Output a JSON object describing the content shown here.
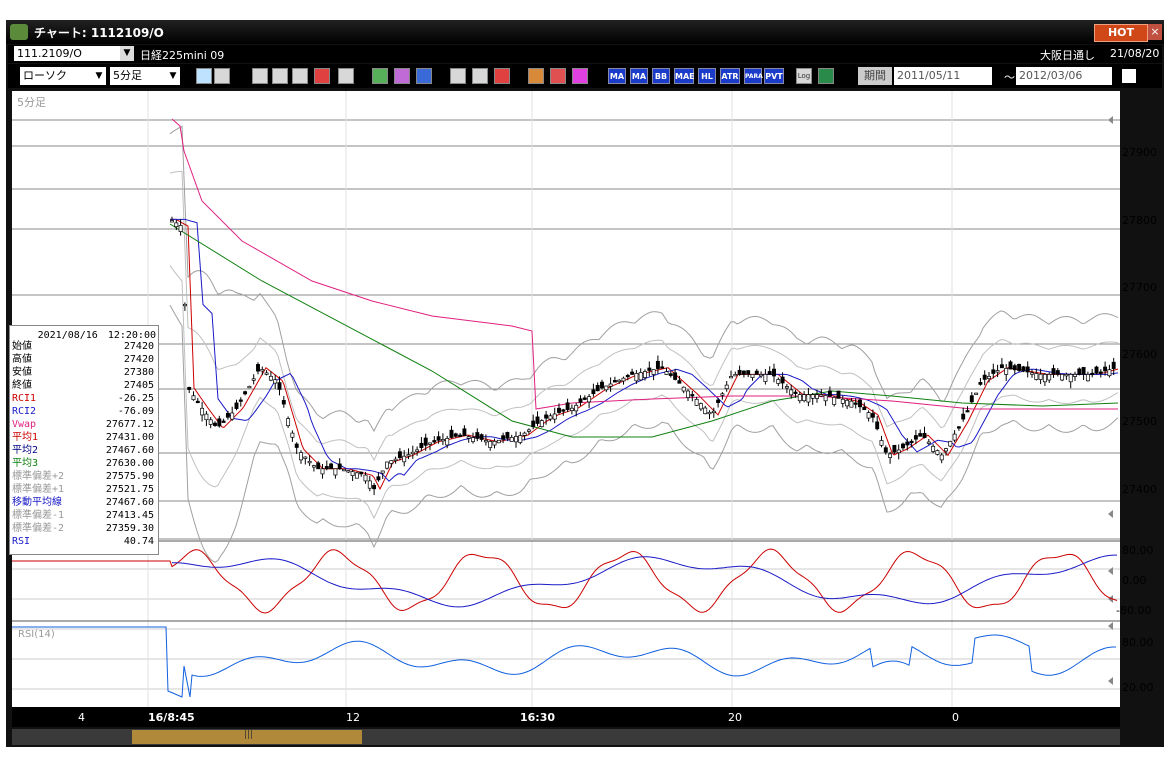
{
  "window": {
    "title": "チャート: 1112109/O",
    "hot_label": "HOT",
    "close_label": "×"
  },
  "info": {
    "symbol": "111.2109/O",
    "name": "日経225mini 09",
    "session": "大阪日通し",
    "date": "21/08/20"
  },
  "toolbar": {
    "chart_type": "ローソク",
    "interval": "5分足",
    "text_buttons": [
      "MA",
      "MA",
      "BB",
      "MAE",
      "HL",
      "ATR",
      "PARA",
      "PVT",
      "Log"
    ],
    "period_label": "期間",
    "date_from": "2011/05/11",
    "date_to": "2012/03/06",
    "tilde": "～"
  },
  "chart": {
    "corner_label": "5分足",
    "price_ticks": [
      "27900",
      "27800",
      "27700",
      "27600",
      "27500",
      "27400"
    ],
    "rci_ticks": [
      "80.00",
      "0.00",
      "-80.00"
    ],
    "rsi_label": "RSI(14)",
    "rsi_ticks": [
      "80.00",
      "20.00"
    ],
    "time_labels": [
      "4",
      "16/8:45",
      "12",
      "16:30",
      "20",
      "0"
    ],
    "colors": {
      "candle_up": "#ffffff",
      "candle_down": "#000000",
      "ma1": "#cc0000",
      "ma2": "#1a1ac8",
      "ma3": "#108010",
      "vwap": "#e02080",
      "bb": "#a0a0a0",
      "rsi": "#1060e0"
    }
  },
  "data_panel": {
    "datetime": "2021/08/16　12:20:00",
    "rows": [
      {
        "label": "始値",
        "value": "27420",
        "color": "#000000"
      },
      {
        "label": "高値",
        "value": "27420",
        "color": "#000000"
      },
      {
        "label": "安値",
        "value": "27380",
        "color": "#000000"
      },
      {
        "label": "終値",
        "value": "27405",
        "color": "#000000"
      },
      {
        "label": "RCI1",
        "value": "-26.25",
        "color": "#cc0000"
      },
      {
        "label": "RCI2",
        "value": "-76.09",
        "color": "#1a1ac8"
      },
      {
        "label": "Vwap",
        "value": "27677.12",
        "color": "#e02080"
      },
      {
        "label": "平均1",
        "value": "27431.00",
        "color": "#cc0000"
      },
      {
        "label": "平均2",
        "value": "27467.60",
        "color": "#000080"
      },
      {
        "label": "平均3",
        "value": "27630.00",
        "color": "#108010"
      },
      {
        "label": "標準偏差+2",
        "value": "27575.90",
        "color": "#999999"
      },
      {
        "label": "標準偏差+1",
        "value": "27521.75",
        "color": "#999999"
      },
      {
        "label": "移動平均線",
        "value": "27467.60",
        "color": "#1a1ac8"
      },
      {
        "label": "標準偏差-1",
        "value": "27413.45",
        "color": "#999999"
      },
      {
        "label": "標準偏差-2",
        "value": "27359.30",
        "color": "#999999"
      },
      {
        "label": "RSI",
        "value": "40.74",
        "color": "#1a1ac8"
      }
    ]
  },
  "scrollbar": {
    "grip": "|||"
  }
}
